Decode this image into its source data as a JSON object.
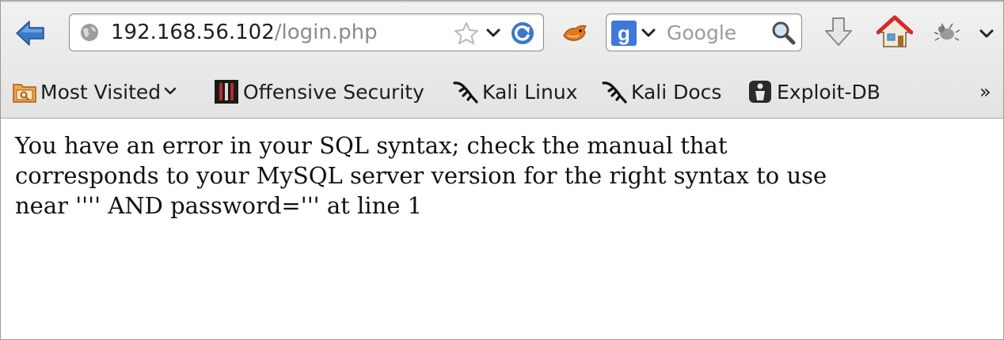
{
  "toolbar": {
    "url": {
      "host": "192.168.56.102",
      "path": "/login.php"
    },
    "search": {
      "placeholder": "Google",
      "engine_badge": "g"
    }
  },
  "bookmarks": [
    {
      "label": "Most Visited",
      "has_dropdown": true
    },
    {
      "label": "Offensive Security"
    },
    {
      "label": "Kali Linux"
    },
    {
      "label": "Kali Docs"
    },
    {
      "label": "Exploit-DB"
    }
  ],
  "bookmarks_overflow": "»",
  "page": {
    "error_lines": [
      "You have an error in your SQL syntax; check the manual that",
      "corresponds to your MySQL server version for the right syntax to use",
      "near '''' AND password=''' at line 1"
    ]
  }
}
